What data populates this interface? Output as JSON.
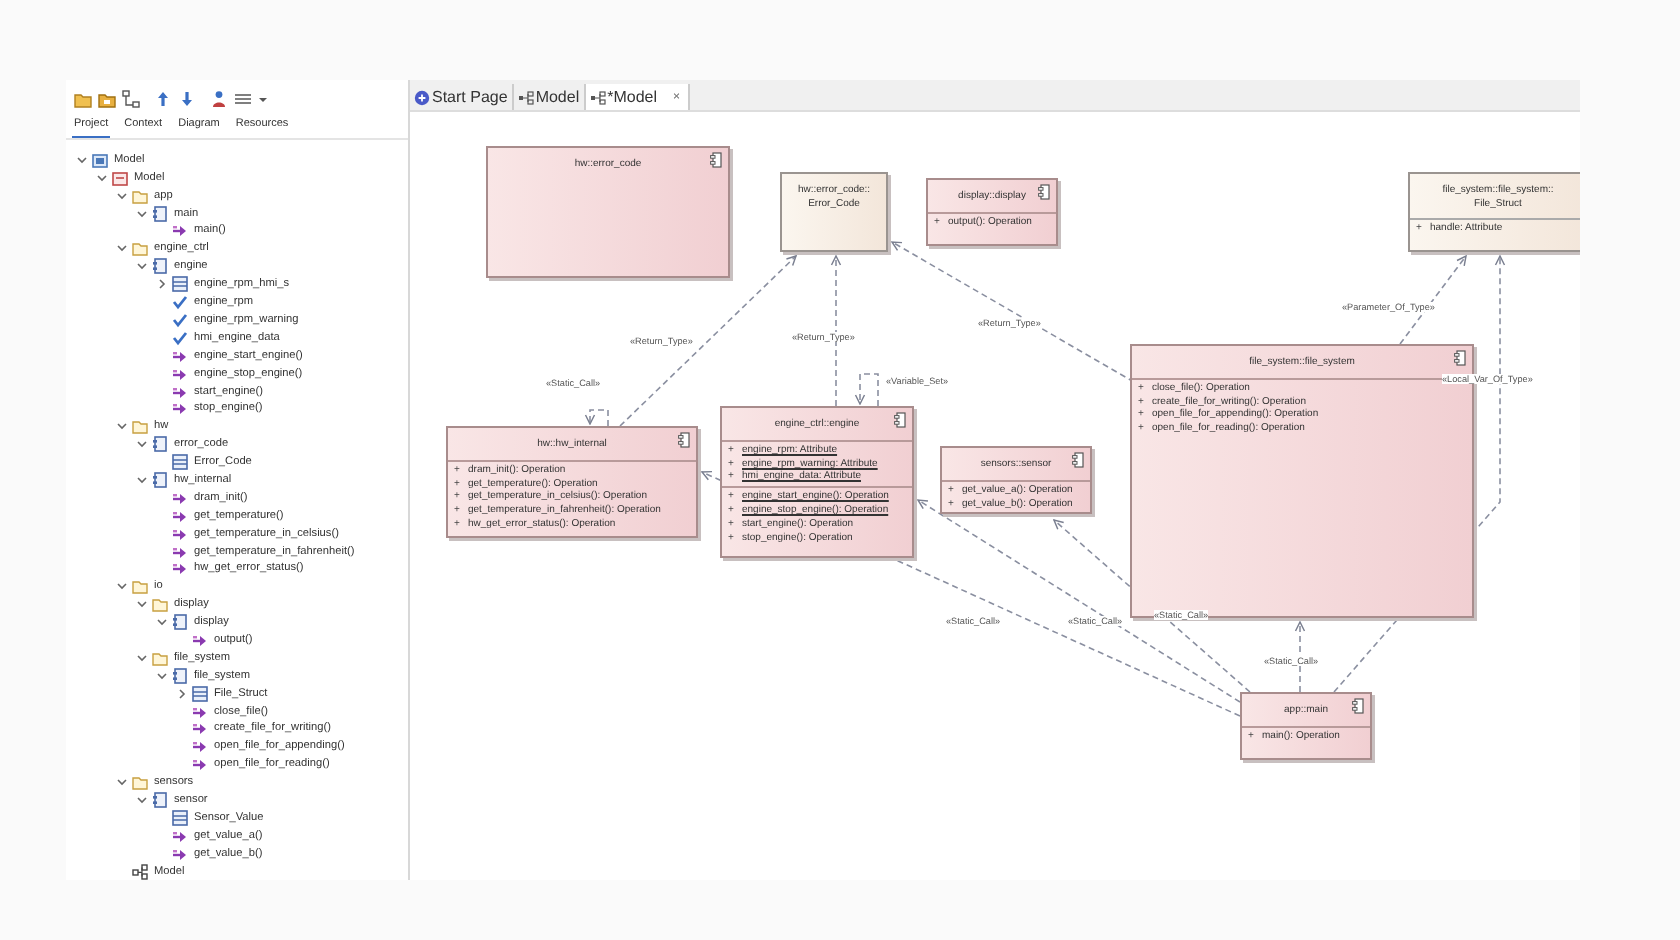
{
  "explorer": {
    "tabs": [
      {
        "label": "Project",
        "selected": true
      },
      {
        "label": "Context",
        "selected": false
      },
      {
        "label": "Diagram",
        "selected": false
      },
      {
        "label": "Resources",
        "selected": false
      }
    ],
    "tree": [
      {
        "label": "Model",
        "kind": "root",
        "expanded": true,
        "children": [
          {
            "label": "Model",
            "kind": "model",
            "expanded": true,
            "children": [
              {
                "label": "app",
                "kind": "folder",
                "expanded": true,
                "children": [
                  {
                    "label": "main",
                    "kind": "component",
                    "expanded": true,
                    "children": [
                      {
                        "label": "main()",
                        "kind": "operation"
                      }
                    ]
                  }
                ]
              },
              {
                "label": "engine_ctrl",
                "kind": "folder",
                "expanded": true,
                "children": [
                  {
                    "label": "engine",
                    "kind": "component",
                    "expanded": true,
                    "children": [
                      {
                        "label": "engine_rpm_hmi_s",
                        "kind": "struct",
                        "expanded": false
                      },
                      {
                        "label": "engine_rpm",
                        "kind": "attribute"
                      },
                      {
                        "label": "engine_rpm_warning",
                        "kind": "attribute"
                      },
                      {
                        "label": "hmi_engine_data",
                        "kind": "attribute"
                      },
                      {
                        "label": "engine_start_engine()",
                        "kind": "operation"
                      },
                      {
                        "label": "engine_stop_engine()",
                        "kind": "operation"
                      },
                      {
                        "label": "start_engine()",
                        "kind": "operation"
                      },
                      {
                        "label": "stop_engine()",
                        "kind": "operation"
                      }
                    ]
                  }
                ]
              },
              {
                "label": "hw",
                "kind": "folder",
                "expanded": true,
                "children": [
                  {
                    "label": "error_code",
                    "kind": "component",
                    "expanded": true,
                    "children": [
                      {
                        "label": "Error_Code",
                        "kind": "struct"
                      }
                    ]
                  },
                  {
                    "label": "hw_internal",
                    "kind": "component",
                    "expanded": true,
                    "children": [
                      {
                        "label": "dram_init()",
                        "kind": "operation"
                      },
                      {
                        "label": "get_temperature()",
                        "kind": "operation"
                      },
                      {
                        "label": "get_temperature_in_celsius()",
                        "kind": "operation"
                      },
                      {
                        "label": "get_temperature_in_fahrenheit()",
                        "kind": "operation"
                      },
                      {
                        "label": "hw_get_error_status()",
                        "kind": "operation"
                      }
                    ]
                  }
                ]
              },
              {
                "label": "io",
                "kind": "folder",
                "expanded": true,
                "children": [
                  {
                    "label": "display",
                    "kind": "folder",
                    "expanded": true,
                    "children": [
                      {
                        "label": "display",
                        "kind": "component",
                        "expanded": true,
                        "children": [
                          {
                            "label": "output()",
                            "kind": "operation"
                          }
                        ]
                      }
                    ]
                  },
                  {
                    "label": "file_system",
                    "kind": "folder",
                    "expanded": true,
                    "children": [
                      {
                        "label": "file_system",
                        "kind": "component",
                        "expanded": true,
                        "children": [
                          {
                            "label": "File_Struct",
                            "kind": "struct",
                            "expanded": false
                          },
                          {
                            "label": "close_file()",
                            "kind": "operation"
                          },
                          {
                            "label": "create_file_for_writing()",
                            "kind": "operation"
                          },
                          {
                            "label": "open_file_for_appending()",
                            "kind": "operation"
                          },
                          {
                            "label": "open_file_for_reading()",
                            "kind": "operation"
                          }
                        ]
                      }
                    ]
                  }
                ]
              },
              {
                "label": "sensors",
                "kind": "folder",
                "expanded": true,
                "children": [
                  {
                    "label": "sensor",
                    "kind": "component",
                    "expanded": true,
                    "children": [
                      {
                        "label": "Sensor_Value",
                        "kind": "struct"
                      },
                      {
                        "label": "get_value_a()",
                        "kind": "operation"
                      },
                      {
                        "label": "get_value_b()",
                        "kind": "operation"
                      }
                    ]
                  }
                ]
              },
              {
                "label": "Model",
                "kind": "diagram"
              }
            ]
          }
        ]
      }
    ]
  },
  "document_tabs": [
    {
      "label": "Start Page",
      "kind": "start",
      "selected": false
    },
    {
      "label": "Model",
      "kind": "diagram",
      "selected": false
    },
    {
      "label": "*Model",
      "kind": "diagram",
      "selected": true,
      "close": "×"
    }
  ],
  "diagram": {
    "elements": [
      {
        "name": "hw::error_code",
        "kind": "component"
      },
      {
        "name": "hw::error_code::Error_Code",
        "kind": "class"
      },
      {
        "name": "display::display",
        "kind": "component",
        "operations": [
          {
            "visibility": "+",
            "text": "output(): Operation",
            "static": false
          }
        ]
      },
      {
        "name": "file_system::file_system::File_Struct",
        "kind": "class",
        "attributes": [
          {
            "visibility": "+",
            "text": "handle: Attribute",
            "static": false
          }
        ]
      },
      {
        "name": "hw::hw_internal",
        "kind": "component",
        "operations": [
          {
            "visibility": "+",
            "text": "dram_init(): Operation",
            "static": false
          },
          {
            "visibility": "+",
            "text": "get_temperature(): Operation",
            "static": false
          },
          {
            "visibility": "+",
            "text": "get_temperature_in_celsius(): Operation",
            "static": false
          },
          {
            "visibility": "+",
            "text": "get_temperature_in_fahrenheit(): Operation",
            "static": false
          },
          {
            "visibility": "+",
            "text": "hw_get_error_status(): Operation",
            "static": false
          }
        ]
      },
      {
        "name": "engine_ctrl::engine",
        "kind": "component",
        "attributes": [
          {
            "visibility": "+",
            "text": "engine_rpm: Attribute",
            "static": true
          },
          {
            "visibility": "+",
            "text": "engine_rpm_warning: Attribute",
            "static": true
          },
          {
            "visibility": "+",
            "text": "hmi_engine_data: Attribute",
            "static": true
          }
        ],
        "operations": [
          {
            "visibility": "+",
            "text": "engine_start_engine(): Operation",
            "static": true
          },
          {
            "visibility": "+",
            "text": "engine_stop_engine(): Operation",
            "static": true
          },
          {
            "visibility": "+",
            "text": "start_engine(): Operation",
            "static": false
          },
          {
            "visibility": "+",
            "text": "stop_engine(): Operation",
            "static": false
          }
        ]
      },
      {
        "name": "sensors::sensor",
        "kind": "component",
        "operations": [
          {
            "visibility": "+",
            "text": "get_value_a(): Operation",
            "static": false
          },
          {
            "visibility": "+",
            "text": "get_value_b(): Operation",
            "static": false
          }
        ]
      },
      {
        "name": "file_system::file_system",
        "kind": "component",
        "operations": [
          {
            "visibility": "+",
            "text": "close_file(): Operation",
            "static": false
          },
          {
            "visibility": "+",
            "text": "create_file_for_writing(): Operation",
            "static": false
          },
          {
            "visibility": "+",
            "text": "open_file_for_appending(): Operation",
            "static": false
          },
          {
            "visibility": "+",
            "text": "open_file_for_reading(): Operation",
            "static": false
          }
        ]
      },
      {
        "name": "app::main",
        "kind": "component",
        "operations": [
          {
            "visibility": "+",
            "text": "main(): Operation",
            "static": false
          }
        ]
      }
    ],
    "connectors": [
      {
        "label": "«Return_Type»"
      },
      {
        "label": "«Static_Call»"
      },
      {
        "label": "«Return_Type»"
      },
      {
        "label": "«Variable_Set»"
      },
      {
        "label": "«Return_Type»"
      },
      {
        "label": "«Parameter_Of_Type»"
      },
      {
        "label": "«Local_Var_Of_Type»"
      },
      {
        "label": "«Static_Call»"
      },
      {
        "label": "«Static_Call»"
      },
      {
        "label": "«Static_Call»"
      },
      {
        "label": "«Static_Call»"
      }
    ]
  }
}
